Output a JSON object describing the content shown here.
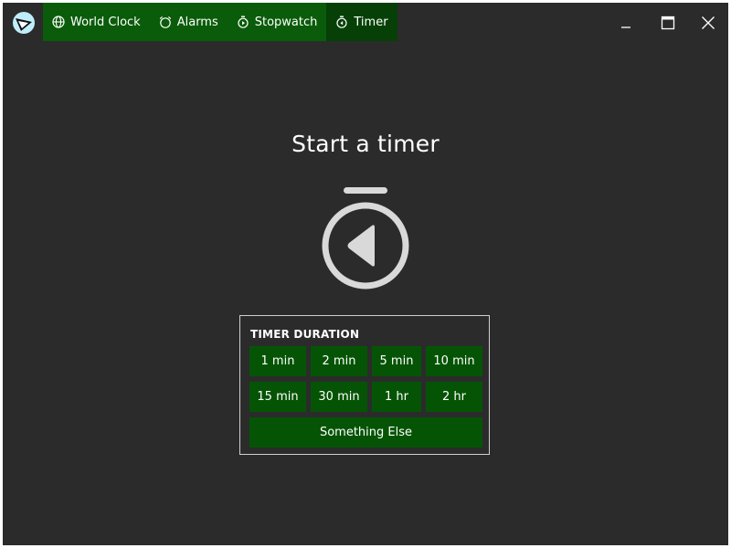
{
  "header": {
    "logo_icon": "clock-app-logo-icon",
    "tabs": [
      {
        "label": "World Clock",
        "icon": "globe-icon",
        "active": false
      },
      {
        "label": "Alarms",
        "icon": "alarm-icon",
        "active": false
      },
      {
        "label": "Stopwatch",
        "icon": "stopwatch-icon",
        "active": false
      },
      {
        "label": "Timer",
        "icon": "timer-icon",
        "active": true
      }
    ],
    "window_controls": [
      "minimize-icon",
      "maximize-icon",
      "close-icon"
    ]
  },
  "main": {
    "title": "Start a timer",
    "hero_icon": "timer-icon",
    "duration_panel": {
      "label": "TIMER DURATION",
      "buttons": [
        "1 min",
        "2 min",
        "5 min",
        "10 min",
        "15 min",
        "30 min",
        "1 hr",
        "2 hr"
      ],
      "other_button": "Something Else"
    }
  },
  "colors": {
    "background": "#2b2b2b",
    "tab_bar": "#0a5c0a",
    "tab_active": "#064006",
    "button": "#055405",
    "icon_gray": "#d9d9d9"
  }
}
